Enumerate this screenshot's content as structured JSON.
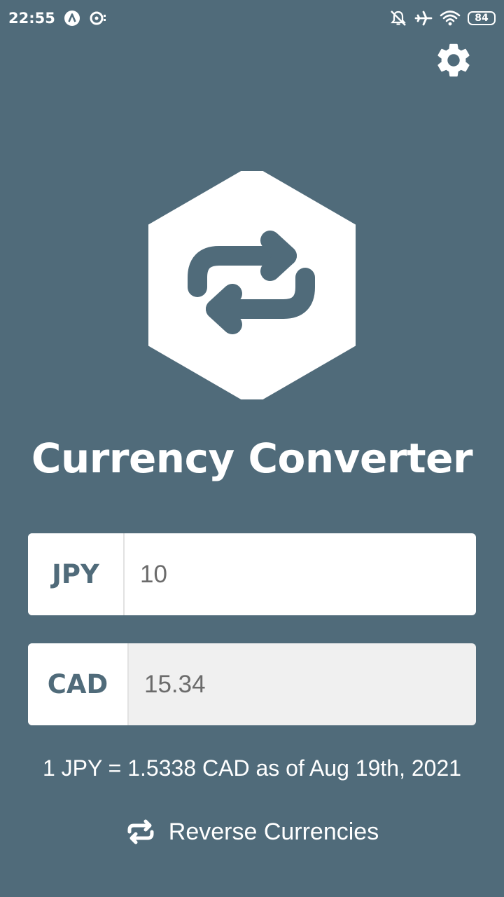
{
  "status_bar": {
    "time": "22:55",
    "icons": [
      "app-notification-icon",
      "media-notification-icon",
      "silent-mode-icon",
      "airplane-mode-icon",
      "wifi-icon"
    ],
    "battery_level": "84"
  },
  "header": {
    "settings_icon": "gear-icon"
  },
  "logo": {
    "icon": "currency-swap-icon"
  },
  "title": "Currency Converter",
  "converter": {
    "base": {
      "currency": "JPY",
      "amount": "10"
    },
    "quote": {
      "currency": "CAD",
      "amount": "15.34"
    }
  },
  "rate_text": "1 JPY = 1.5338 CAD as of Aug 19th, 2021",
  "reverse": {
    "label": "Reverse Currencies",
    "icon": "swap-icon"
  },
  "colors": {
    "background": "#506b7a",
    "surface": "#ffffff",
    "disabled_input": "#f0f0f0"
  }
}
